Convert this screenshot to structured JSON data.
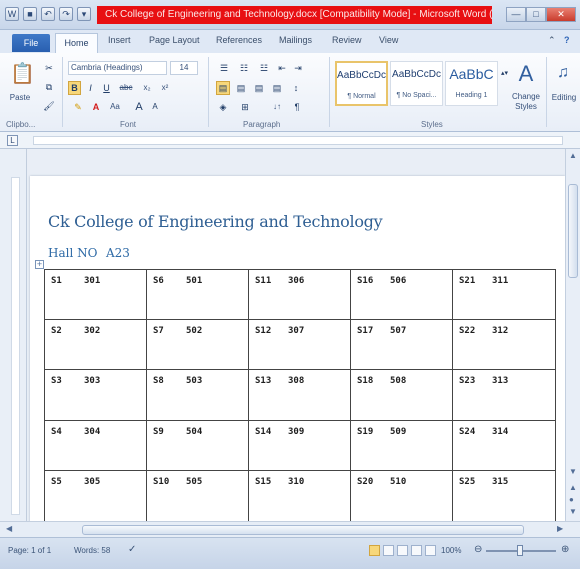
{
  "window": {
    "title": "Ck College of Engineering and Technology.docx [Compatibility Mode] - Microsoft Word (Produ...",
    "min": "—",
    "max": "□",
    "close": "✕"
  },
  "tabs": {
    "file": "File",
    "home": "Home",
    "insert": "Insert",
    "page_layout": "Page Layout",
    "references": "References",
    "mailings": "Mailings",
    "review": "Review",
    "view": "View"
  },
  "ribbon": {
    "clipboard": {
      "paste": "Paste",
      "label": "Clipbo..."
    },
    "font": {
      "name": "Cambria (Headings)",
      "size": "14",
      "bold": "B",
      "italic": "I",
      "underline": "U",
      "strike": "abc",
      "sub": "x₂",
      "sup": "x²",
      "grow": "A",
      "shrink": "A",
      "color": "A",
      "clear": "Aa",
      "label": "Font"
    },
    "paragraph": {
      "label": "Paragraph",
      "sort": "↓↑",
      "pilcrow": "¶"
    },
    "styles": {
      "items": [
        {
          "sample": "AaBbCcDc",
          "name": "¶ Normal"
        },
        {
          "sample": "AaBbCcDc",
          "name": "¶ No Spaci..."
        },
        {
          "sample": "AaBbC",
          "name": "Heading 1"
        }
      ],
      "change": "Change Styles",
      "label": "Styles"
    },
    "editing": "Editing"
  },
  "document": {
    "title": "Ck College of Engineering and Technology",
    "hall_label": "Hall NO",
    "hall_no": "A23",
    "rows": [
      [
        {
          "seat": "S1",
          "room": "301"
        },
        {
          "seat": "S6",
          "room": "501"
        },
        {
          "seat": "S11",
          "room": "306"
        },
        {
          "seat": "S16",
          "room": "506"
        },
        {
          "seat": "S21",
          "room": "311"
        }
      ],
      [
        {
          "seat": "S2",
          "room": "302"
        },
        {
          "seat": "S7",
          "room": "502"
        },
        {
          "seat": "S12",
          "room": "307"
        },
        {
          "seat": "S17",
          "room": "507"
        },
        {
          "seat": "S22",
          "room": "312"
        }
      ],
      [
        {
          "seat": "S3",
          "room": "303"
        },
        {
          "seat": "S8",
          "room": "503"
        },
        {
          "seat": "S13",
          "room": "308"
        },
        {
          "seat": "S18",
          "room": "508"
        },
        {
          "seat": "S23",
          "room": "313"
        }
      ],
      [
        {
          "seat": "S4",
          "room": "304"
        },
        {
          "seat": "S9",
          "room": "504"
        },
        {
          "seat": "S14",
          "room": "309"
        },
        {
          "seat": "S19",
          "room": "509"
        },
        {
          "seat": "S24",
          "room": "314"
        }
      ],
      [
        {
          "seat": "S5",
          "room": "305"
        },
        {
          "seat": "S10",
          "room": "505"
        },
        {
          "seat": "S15",
          "room": "310"
        },
        {
          "seat": "S20",
          "room": "510"
        },
        {
          "seat": "S25",
          "room": "315"
        }
      ]
    ]
  },
  "statusbar": {
    "page": "Page: 1 of 1",
    "words": "Words: 58",
    "zoom": "100%"
  }
}
